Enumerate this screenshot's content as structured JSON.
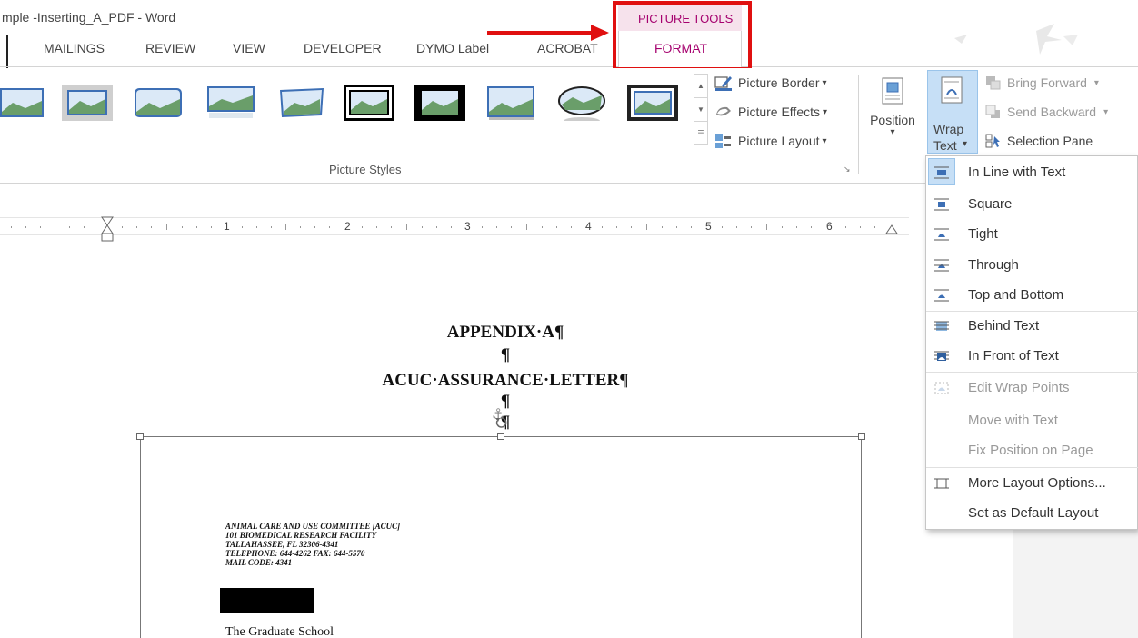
{
  "window": {
    "title": "mple -Inserting_A_PDF - Word"
  },
  "tabs": [
    {
      "label": "MAILINGS"
    },
    {
      "label": "REVIEW"
    },
    {
      "label": "VIEW"
    },
    {
      "label": "DEVELOPER"
    },
    {
      "label": "DYMO Label"
    },
    {
      "label": "ACROBAT"
    }
  ],
  "contextual": {
    "header": "PICTURE TOOLS",
    "tab": "FORMAT"
  },
  "ribbon": {
    "picture_border": "Picture Border",
    "picture_effects": "Picture Effects",
    "picture_layout": "Picture Layout",
    "picture_styles_label": "Picture Styles",
    "position": "Position",
    "wrap_line1": "Wrap",
    "wrap_line2": "Text",
    "bring_forward": "Bring Forward",
    "send_backward": "Send Backward",
    "selection_pane": "Selection Pane",
    "dropdown_arrow": "▾"
  },
  "ruler": {
    "numbers": [
      "1",
      "2",
      "3",
      "4",
      "5",
      "6"
    ]
  },
  "document": {
    "line1": "APPENDIX·A¶",
    "line2": "¶",
    "line3": "ACUC·ASSURANCE·LETTER¶",
    "line4": "¶",
    "line5": "¶",
    "letter_head": [
      "ANIMAL CARE AND USE COMMITTEE [ACUC]",
      "101 BIOMEDICAL RESEARCH FACILITY",
      "TALLAHASSEE, FL 32306-4341",
      "TELEPHONE: 644-4262   FAX: 644-5570",
      "MAIL CODE: 4341"
    ],
    "grad_school": "The Graduate School"
  },
  "wrap_menu": {
    "items": [
      {
        "label": "In Line with Text",
        "icon": "inline-wrap-icon"
      },
      {
        "label": "Square",
        "icon": "square-wrap-icon"
      },
      {
        "label": "Tight",
        "icon": "tight-wrap-icon"
      },
      {
        "label": "Through",
        "icon": "through-wrap-icon"
      },
      {
        "label": "Top and Bottom",
        "icon": "top-bottom-wrap-icon"
      },
      {
        "label": "Behind Text",
        "icon": "behind-text-icon"
      },
      {
        "label": "In Front of Text",
        "icon": "in-front-text-icon"
      },
      {
        "label": "Edit Wrap Points",
        "icon": "edit-wrap-points-icon"
      },
      {
        "label": "Move with Text"
      },
      {
        "label": "Fix Position on Page"
      },
      {
        "label": "More Layout Options...",
        "icon": "layout-options-icon"
      },
      {
        "label": "Set as Default Layout"
      }
    ]
  },
  "colors": {
    "accent": "#a5006e",
    "highlight": "#c6dff6",
    "annotation_red": "#e01010"
  }
}
